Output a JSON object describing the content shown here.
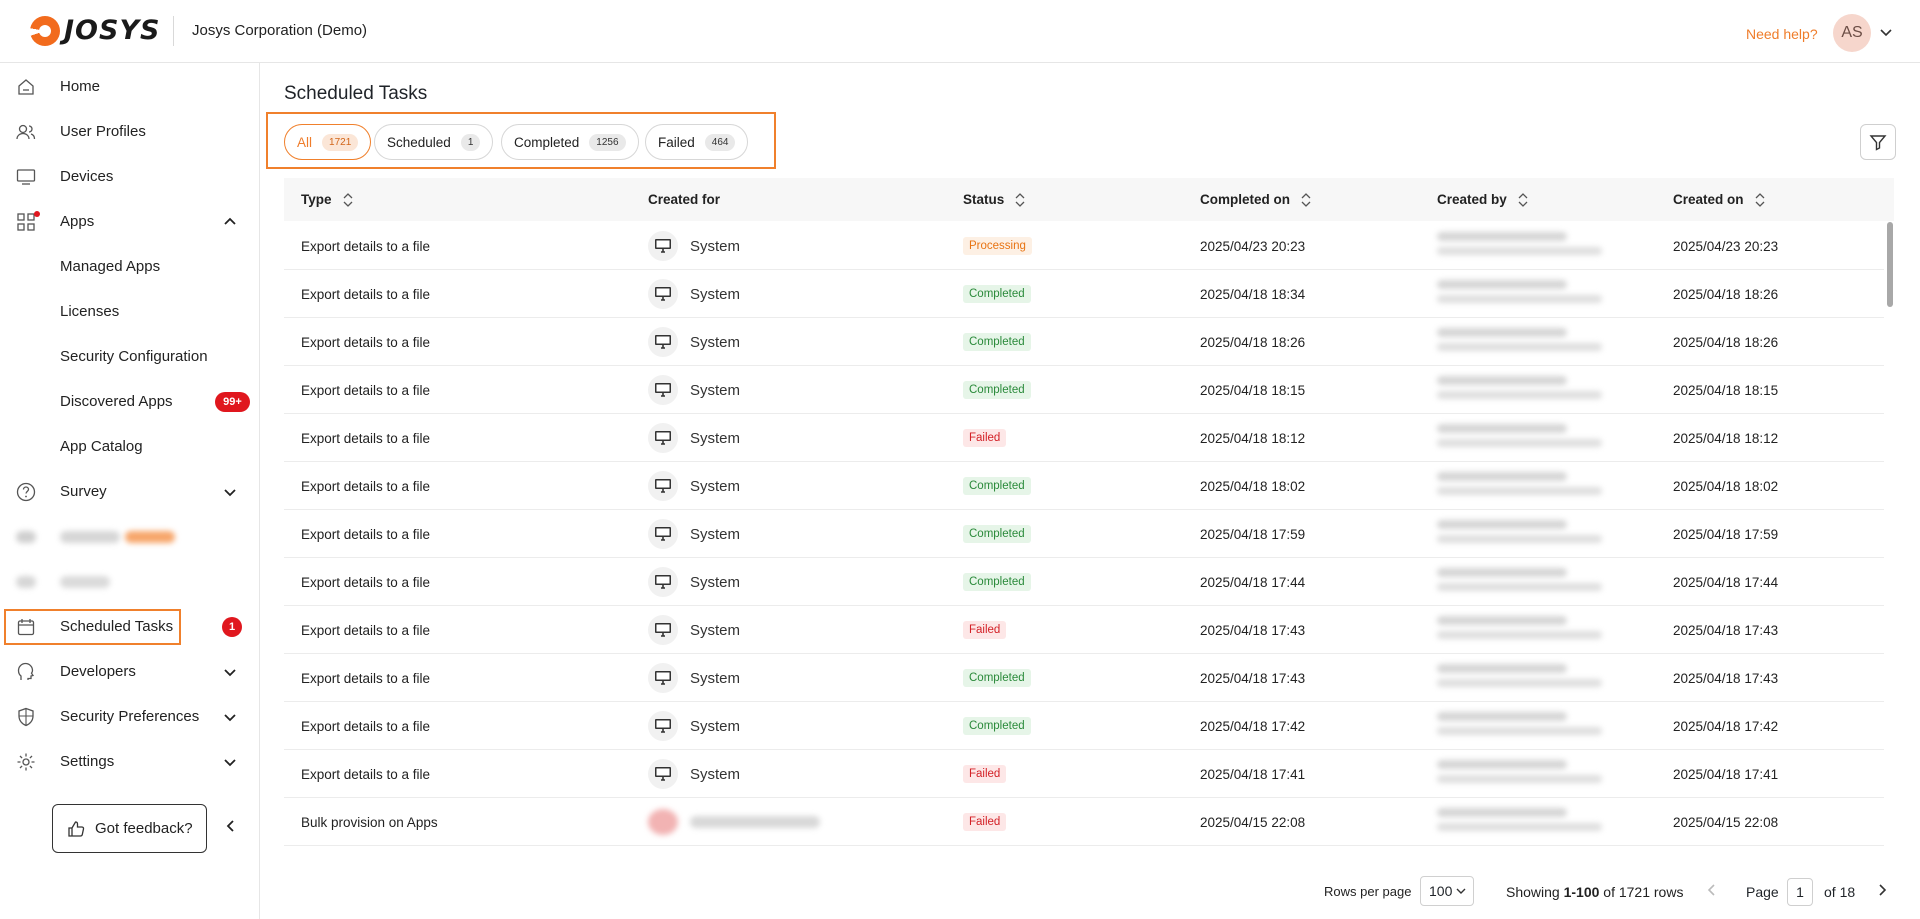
{
  "header": {
    "logo_text": "JOSYS",
    "org_name": "Josys Corporation (Demo)",
    "help_link": "Need help?",
    "avatar_initials": "AS"
  },
  "sidebar": {
    "items": [
      {
        "label": "Home",
        "icon": "home-icon"
      },
      {
        "label": "User Profiles",
        "icon": "users-icon"
      },
      {
        "label": "Devices",
        "icon": "monitor-icon"
      },
      {
        "label": "Apps",
        "icon": "apps-grid-icon"
      },
      {
        "label": "Managed Apps"
      },
      {
        "label": "Licenses"
      },
      {
        "label": "Security Configuration"
      },
      {
        "label": "Discovered Apps",
        "badge": "99+"
      },
      {
        "label": "App Catalog"
      },
      {
        "label": "Survey",
        "icon": "question-circle-icon"
      },
      {
        "label": "Scheduled Tasks",
        "icon": "calendar-icon",
        "badge": "1"
      },
      {
        "label": "Developers",
        "icon": "developer-icon"
      },
      {
        "label": "Security Preferences",
        "icon": "shield-icon"
      },
      {
        "label": "Settings",
        "icon": "gear-icon"
      }
    ],
    "feedback_label": "Got feedback?"
  },
  "main": {
    "title": "Scheduled Tasks",
    "tabs": [
      {
        "label": "All",
        "count": "1721",
        "active": true
      },
      {
        "label": "Scheduled",
        "count": "1"
      },
      {
        "label": "Completed",
        "count": "1256"
      },
      {
        "label": "Failed",
        "count": "464"
      }
    ],
    "columns": [
      "Type",
      "Created for",
      "Status",
      "Completed on",
      "Created by",
      "Created on"
    ],
    "rows": [
      {
        "type": "Export details to a file",
        "created_for": "System",
        "status": "Processing",
        "completed_on": "2025/04/23 20:23",
        "created_on": "2025/04/23 20:23"
      },
      {
        "type": "Export details to a file",
        "created_for": "System",
        "status": "Completed",
        "completed_on": "2025/04/18 18:34",
        "created_on": "2025/04/18 18:26"
      },
      {
        "type": "Export details to a file",
        "created_for": "System",
        "status": "Completed",
        "completed_on": "2025/04/18 18:26",
        "created_on": "2025/04/18 18:26"
      },
      {
        "type": "Export details to a file",
        "created_for": "System",
        "status": "Completed",
        "completed_on": "2025/04/18 18:15",
        "created_on": "2025/04/18 18:15"
      },
      {
        "type": "Export details to a file",
        "created_for": "System",
        "status": "Failed",
        "completed_on": "2025/04/18 18:12",
        "created_on": "2025/04/18 18:12"
      },
      {
        "type": "Export details to a file",
        "created_for": "System",
        "status": "Completed",
        "completed_on": "2025/04/18 18:02",
        "created_on": "2025/04/18 18:02"
      },
      {
        "type": "Export details to a file",
        "created_for": "System",
        "status": "Completed",
        "completed_on": "2025/04/18 17:59",
        "created_on": "2025/04/18 17:59"
      },
      {
        "type": "Export details to a file",
        "created_for": "System",
        "status": "Completed",
        "completed_on": "2025/04/18 17:44",
        "created_on": "2025/04/18 17:44"
      },
      {
        "type": "Export details to a file",
        "created_for": "System",
        "status": "Failed",
        "completed_on": "2025/04/18 17:43",
        "created_on": "2025/04/18 17:43"
      },
      {
        "type": "Export details to a file",
        "created_for": "System",
        "status": "Completed",
        "completed_on": "2025/04/18 17:43",
        "created_on": "2025/04/18 17:43"
      },
      {
        "type": "Export details to a file",
        "created_for": "System",
        "status": "Completed",
        "completed_on": "2025/04/18 17:42",
        "created_on": "2025/04/18 17:42"
      },
      {
        "type": "Export details to a file",
        "created_for": "System",
        "status": "Failed",
        "completed_on": "2025/04/18 17:41",
        "created_on": "2025/04/18 17:41"
      },
      {
        "type": "Bulk provision on Apps",
        "created_for": "",
        "status": "Failed",
        "completed_on": "2025/04/15 22:08",
        "created_on": "2025/04/15 22:08"
      }
    ]
  },
  "pagination": {
    "rows_per_page_label": "Rows per page",
    "rows_per_page": "100",
    "showing_prefix": "Showing ",
    "showing_range": "1-100",
    "showing_suffix": " of 1721 rows",
    "page_label": "Page",
    "page": "1",
    "of_label": "of 18"
  },
  "colors": {
    "accent": "#f0802c",
    "badge_red": "#e0171e",
    "status_processing": "#e87413",
    "status_completed": "#2a8a3a",
    "status_failed": "#d32127"
  }
}
